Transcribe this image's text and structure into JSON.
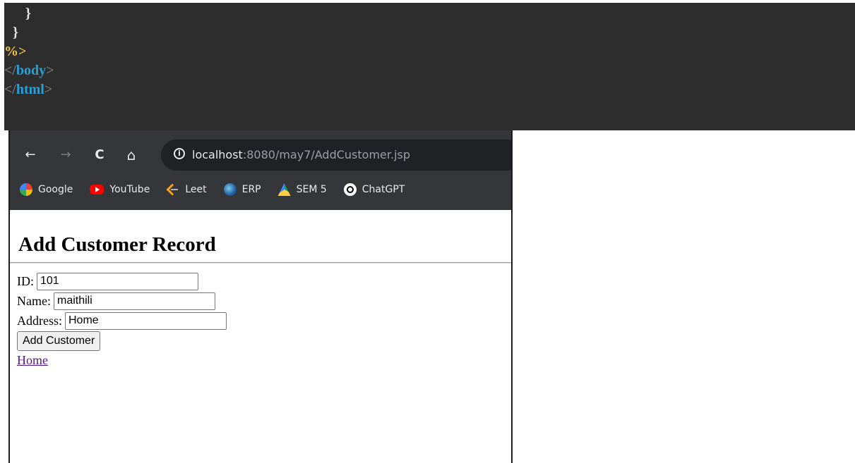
{
  "code_editor": {
    "lines": {
      "l1": "}",
      "l2": "}",
      "l3": "%>"
    },
    "body_close": {
      "open": "</",
      "name": "body",
      "close": ">"
    },
    "html_close": {
      "open": "</",
      "name": "html",
      "close": ">"
    }
  },
  "browser": {
    "nav": {
      "back": "←",
      "forward": "→",
      "reload": "C",
      "home": "⌂"
    },
    "address": {
      "info_icon": "i",
      "host": "localhost",
      "rest": ":8080/may7/AddCustomer.jsp"
    },
    "bookmarks": [
      {
        "label": "Google",
        "icon": "google-icon"
      },
      {
        "label": "YouTube",
        "icon": "youtube-icon"
      },
      {
        "label": "Leet",
        "icon": "leetcode-icon"
      },
      {
        "label": "ERP",
        "icon": "erp-icon"
      },
      {
        "label": "SEM 5",
        "icon": "google-drive-icon"
      },
      {
        "label": "ChatGPT",
        "icon": "chatgpt-icon"
      }
    ]
  },
  "page": {
    "heading": "Add Customer Record",
    "form": {
      "id_label": "ID:",
      "id_value": "101",
      "name_label": "Name:",
      "name_value": "maithili",
      "address_label": "Address:",
      "address_value": "Home",
      "submit_label": "Add Customer"
    },
    "home_link": "Home"
  },
  "colors": {
    "editor_bg": "#2d2d2d",
    "tag_blue": "#2a9fd6",
    "scriptlet_yellow": "#f2c14e",
    "browser_toolbar": "#35363a",
    "visited_link": "#551a8b"
  }
}
